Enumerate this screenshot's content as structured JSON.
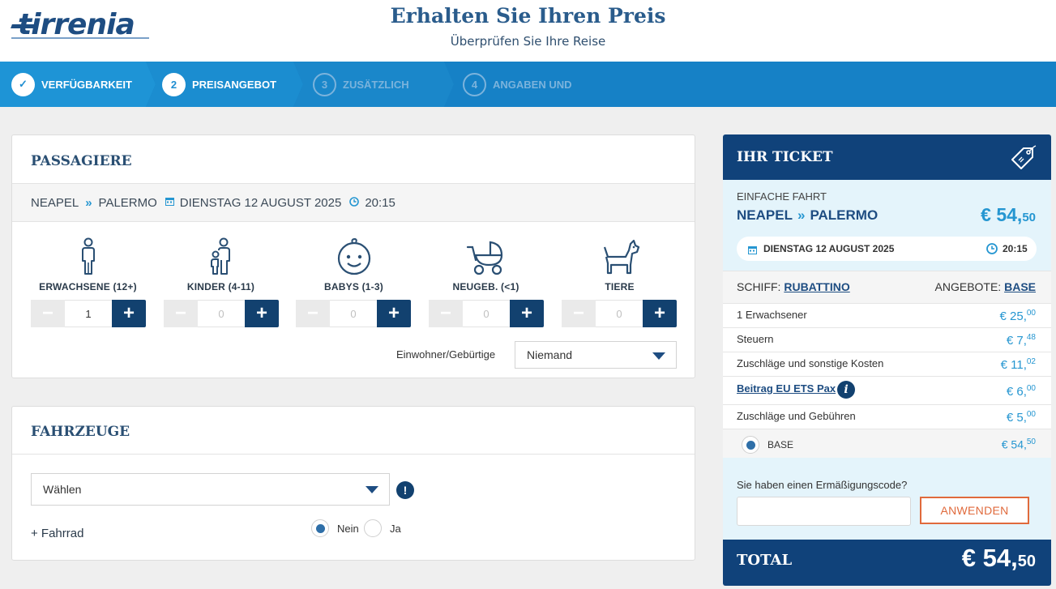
{
  "header": {
    "logo": "tirrenia",
    "title": "Erhalten Sie Ihren Preis",
    "subtitle": "Überprüfen Sie Ihre Reise"
  },
  "steps": [
    {
      "label": "VERFÜGBARKEIT",
      "badge": "✓",
      "state": "done"
    },
    {
      "label": "PREISANGEBOT",
      "badge": "2",
      "state": "active"
    },
    {
      "label": "ZUSÄTZLICH",
      "badge": "3",
      "state": "inactive"
    },
    {
      "label": "ANGABEN UND",
      "badge": "4",
      "state": "inactive"
    }
  ],
  "passengers": {
    "title": "PASSAGIERE",
    "route": {
      "from": "NEAPEL",
      "to": "PALERMO",
      "date": "DIENSTAG 12 AUGUST 2025",
      "time": "20:15"
    },
    "types": [
      {
        "label": "ERWACHSENE (12+)",
        "count": "1",
        "icon": "adult-icon"
      },
      {
        "label": "KINDER (4-11)",
        "count": "0",
        "icon": "child-icon"
      },
      {
        "label": "BABYS (1-3)",
        "count": "0",
        "icon": "baby-face-icon"
      },
      {
        "label": "NEUGEB. (<1)",
        "count": "0",
        "icon": "stroller-icon"
      },
      {
        "label": "TIERE",
        "count": "0",
        "icon": "dog-icon"
      }
    ],
    "minus_symbol": "−",
    "plus_symbol": "+",
    "resident_label": "Einwohner/Gebürtige",
    "resident_value": "Niemand"
  },
  "vehicles": {
    "title": "FAHRZEUGE",
    "select_value": "Wählen",
    "alert_symbol": "!",
    "bike_label": "+ Fahrrad",
    "no_label": "Nein",
    "yes_label": "Ja",
    "bike_selected": "Nein"
  },
  "ticket": {
    "title": "IHR TICKET",
    "trip_type": "EINFACHE FAHRT",
    "from": "NEAPEL",
    "to": "PALERMO",
    "price_main": "€ 54,",
    "price_cents": "50",
    "date": "DIENSTAG 12 AUGUST 2025",
    "time": "20:15",
    "ship_label": "SCHIFF:",
    "ship_name": "RUBATTINO",
    "offer_label": "ANGEBOTE:",
    "offer_name": "BASE",
    "lines": [
      {
        "label": "1 Erwachsener",
        "main": "€ 25,",
        "cents": "00"
      },
      {
        "label": "Steuern",
        "main": "€ 7,",
        "cents": "48"
      },
      {
        "label": "Zuschläge und sonstige Kosten",
        "main": "€ 11,",
        "cents": "02"
      },
      {
        "label": "Beitrag EU ETS Pax",
        "main": "€ 6,",
        "cents": "00"
      },
      {
        "label": "Zuschläge und Gebühren",
        "main": "€ 5,",
        "cents": "00"
      }
    ],
    "fare_option": {
      "label": "BASE",
      "main": "€ 54,",
      "cents": "50"
    },
    "info_symbol": "i",
    "promo_question": "Sie haben einen Ermäßigungscode?",
    "promo_value": "",
    "apply_label": "ANWENDEN",
    "total_label": "TOTAL",
    "total_main": "€ 54,",
    "total_cents": "50"
  },
  "colors": {
    "brand_navy": "#10427a",
    "steps_blue": "#1681c6",
    "accent_blue": "#2596d1",
    "apply_orange": "#e06a3c"
  }
}
